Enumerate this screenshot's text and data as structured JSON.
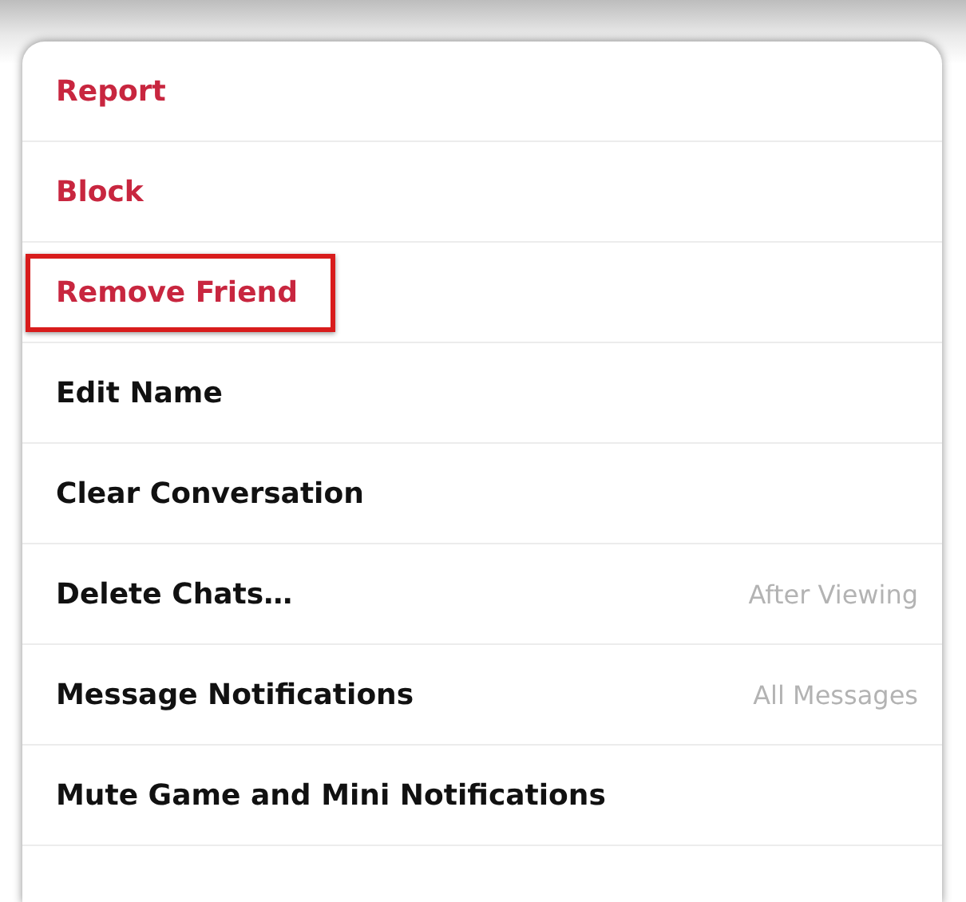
{
  "menu": {
    "items": [
      {
        "label": "Report",
        "kind": "danger",
        "highlighted": false
      },
      {
        "label": "Block",
        "kind": "danger",
        "highlighted": false
      },
      {
        "label": "Remove Friend",
        "kind": "danger",
        "highlighted": true
      },
      {
        "label": "Edit Name",
        "kind": "normal",
        "highlighted": false
      },
      {
        "label": "Clear Conversation",
        "kind": "normal",
        "highlighted": false
      },
      {
        "label": "Delete Chats…",
        "kind": "normal",
        "highlighted": false,
        "value": "After Viewing"
      },
      {
        "label": "Message Notifications",
        "kind": "normal",
        "highlighted": false,
        "value": "All Messages"
      },
      {
        "label": "Mute Game and Mini Notifications",
        "kind": "normal",
        "highlighted": false
      }
    ]
  }
}
